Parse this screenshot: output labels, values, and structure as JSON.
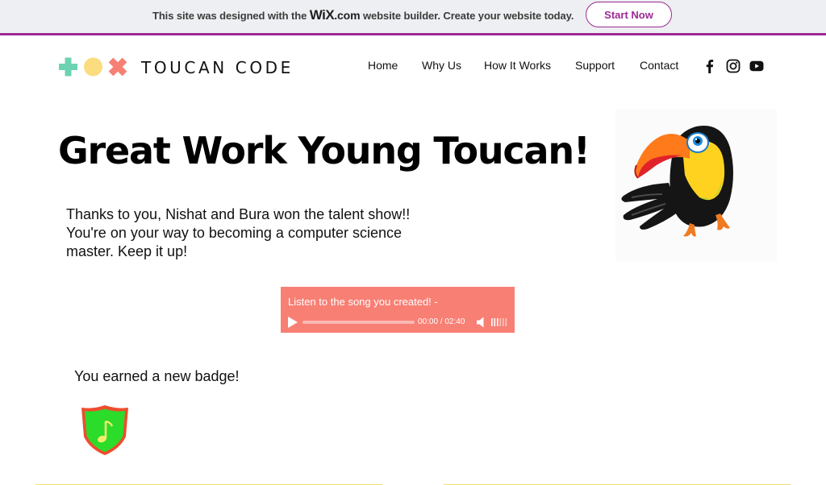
{
  "wix_banner": {
    "text_before": "This site was designed with the ",
    "logo": "WiX",
    "logo_suffix": ".com",
    "text_after": " website builder. Create your website today.",
    "button": "Start Now",
    "accent_color": "#9b2a93"
  },
  "header": {
    "brand": "TOUCAN CODE",
    "logo_icons": [
      "plus-icon",
      "circle-icon",
      "x-icon"
    ],
    "logo_colors": [
      "#6dd2b2",
      "#fbdc7e",
      "#f87f74"
    ],
    "nav": [
      "Home",
      "Why Us",
      "How It Works",
      "Support",
      "Contact"
    ],
    "social": [
      "facebook-icon",
      "instagram-icon",
      "youtube-icon"
    ]
  },
  "main": {
    "headline": "Great Work Young Toucan!",
    "message": "Thanks to you, Nishat and Bura won the talent show!! You're on your way to becoming a computer science master. Keep it up!",
    "audio": {
      "title": "Listen to the song you created! -",
      "time": "00:00 / 02:40",
      "progress": 0,
      "background_color": "#f87f74"
    },
    "badge_text": "You earned a new badge!",
    "badge_icon": "music-note-shield-icon",
    "mascot_icon": "toucan-illustration"
  }
}
